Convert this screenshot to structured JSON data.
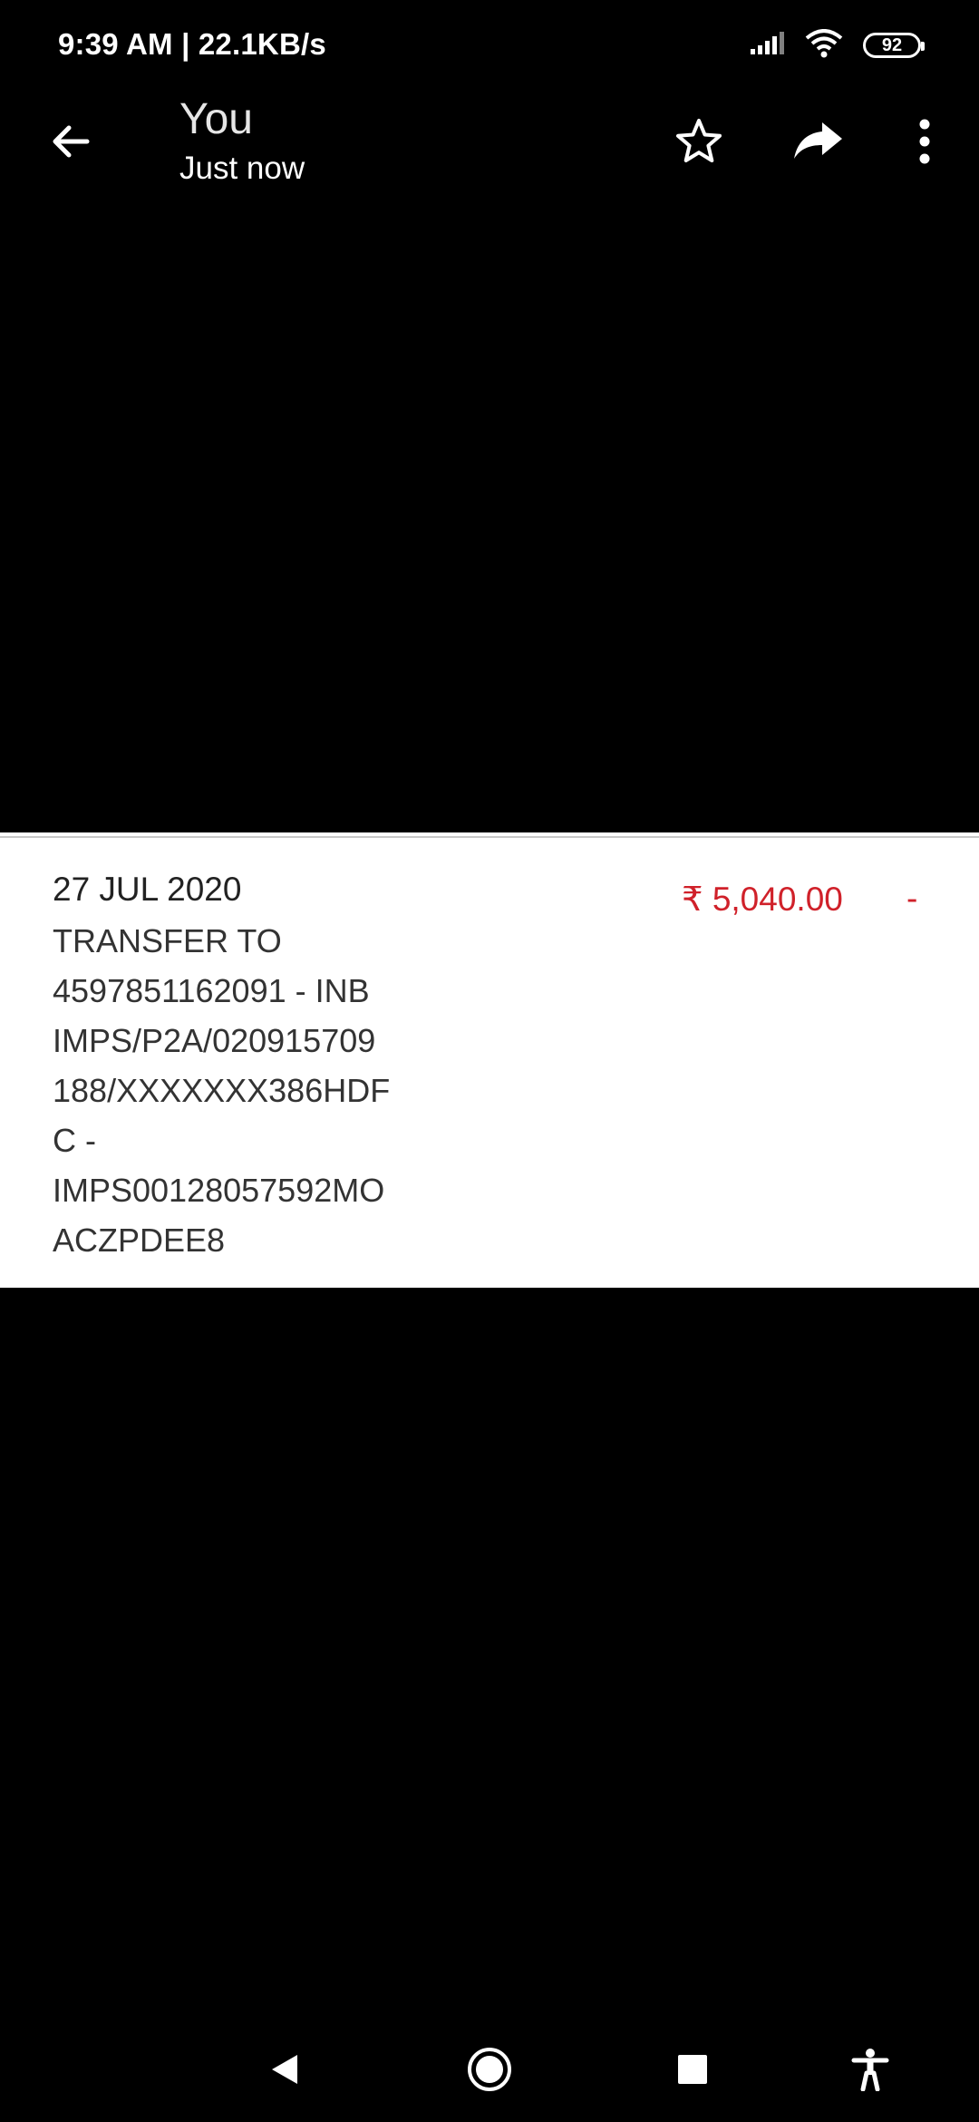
{
  "status_bar": {
    "time_speed": "9:39 AM | 22.1KB/s",
    "battery": "92",
    "icons": [
      "signal-icon",
      "wifi-icon",
      "battery-icon"
    ]
  },
  "app_bar": {
    "title": "You",
    "subtitle": "Just now",
    "icons": [
      "back-arrow-icon",
      "star-icon",
      "share-icon",
      "more-vert-icon"
    ]
  },
  "transaction": {
    "date": "27 JUL 2020",
    "description_lines": [
      "TRANSFER TO",
      "4597851162091 - INB",
      "IMPS/P2A/020915709",
      "188/XXXXXXX386HDF",
      "C -",
      "IMPS00128057592MO",
      "ACZPDEE8"
    ],
    "amount": "₹ 5,040.00",
    "dash": "-"
  },
  "nav_bar": {
    "icons": [
      "nav-back-icon",
      "nav-home-icon",
      "nav-recents-icon",
      "accessibility-icon"
    ]
  },
  "colors": {
    "background": "#000000",
    "amount_red": "#d0212a"
  }
}
